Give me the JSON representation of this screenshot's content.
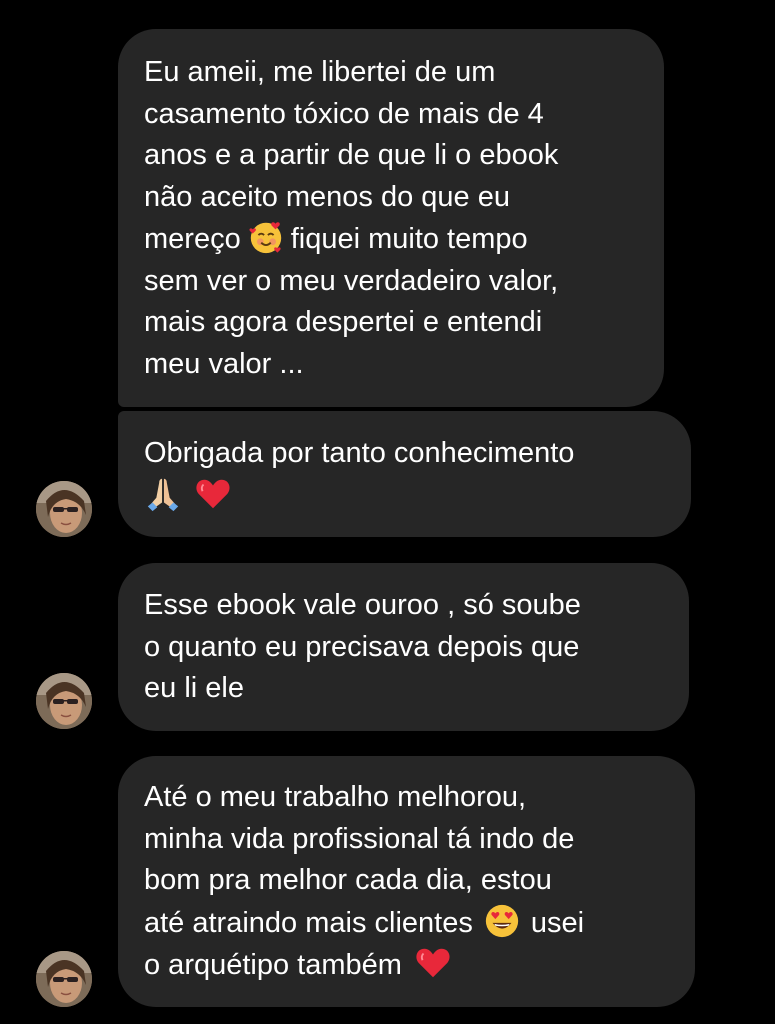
{
  "messages": [
    {
      "lines": [
        "Eu ameii, me libertei de um",
        "casamento tóxico de mais de 4",
        "anos e a partir de que li o ebook",
        "não aceito menos do que eu",
        {
          "before": "mereço",
          "emoji": "smiling-face-with-hearts",
          "after": "fiquei muito tempo"
        },
        "sem ver o meu verdadeiro valor,",
        "mais agora despertei e entendi",
        "meu valor ..."
      ]
    },
    {
      "lines": [
        "Obrigada por tanto conhecimento",
        {
          "emoji": [
            "folded-hands",
            "red-heart"
          ]
        }
      ]
    },
    {
      "lines": [
        "Esse ebook vale ouroo , só soube",
        "o quanto eu precisava depois que",
        "eu li ele"
      ]
    },
    {
      "lines": [
        "Até o meu trabalho melhorou,",
        "minha vida profissional tá indo de",
        "bom pra melhor cada dia, estou",
        {
          "before": "até atraindo mais clientes",
          "emoji": "smiling-face-with-heart-eyes",
          "after": "usei"
        },
        {
          "before": "o arquétipo também",
          "emoji": "red-heart"
        }
      ]
    }
  ],
  "text": {
    "m1_l1": "Eu ameii, me libertei de um",
    "m1_l2": "casamento tóxico de mais de 4",
    "m1_l3": "anos e a partir de que li o ebook",
    "m1_l4": "não aceito menos do que eu",
    "m1_l5a": "mereço",
    "m1_l5b": "fiquei muito tempo",
    "m1_l6": "sem ver o meu verdadeiro valor,",
    "m1_l7": "mais agora despertei e entendi",
    "m1_l8": "meu valor ...",
    "m2_l1": "Obrigada por tanto conhecimento",
    "m3_l1": "Esse ebook vale ouroo , só soube",
    "m3_l2": "o quanto eu precisava depois que",
    "m3_l3": "eu li ele",
    "m4_l1": "Até o meu trabalho melhorou,",
    "m4_l2": "minha vida profissional tá indo de",
    "m4_l3": "bom pra melhor cada dia, estou",
    "m4_l4a": "até atraindo mais clientes",
    "m4_l4b": "usei",
    "m4_l5": "o arquétipo também"
  },
  "colors": {
    "background": "#000000",
    "bubble": "#262626",
    "text": "#ffffff"
  }
}
